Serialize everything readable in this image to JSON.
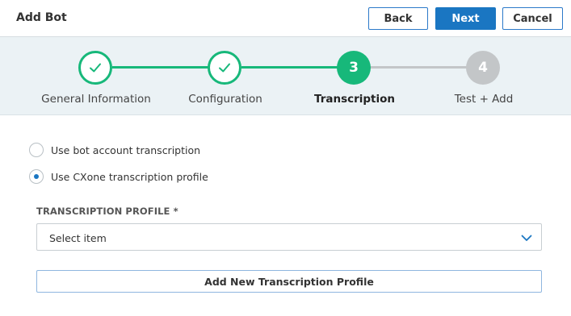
{
  "header": {
    "title": "Add Bot",
    "back_label": "Back",
    "next_label": "Next",
    "cancel_label": "Cancel"
  },
  "colors": {
    "primary": "#1a76c2",
    "success": "#17b87a",
    "inactive": "#c3c6c8",
    "stepper_bg": "#ebf2f5"
  },
  "stepper": {
    "steps": [
      {
        "label": "General Information",
        "state": "done",
        "icon": "check-icon"
      },
      {
        "label": "Configuration",
        "state": "done",
        "icon": "check-icon"
      },
      {
        "label": "Transcription",
        "state": "active",
        "number": "3"
      },
      {
        "label": "Test + Add",
        "state": "todo",
        "number": "4"
      }
    ]
  },
  "transcription": {
    "options": [
      {
        "label": "Use bot account transcription",
        "checked": false
      },
      {
        "label": "Use CXone transcription profile",
        "checked": true
      }
    ],
    "profile_label": "TRANSCRIPTION PROFILE *",
    "profile_value": "Select item",
    "add_profile_label": "Add New Transcription Profile"
  }
}
